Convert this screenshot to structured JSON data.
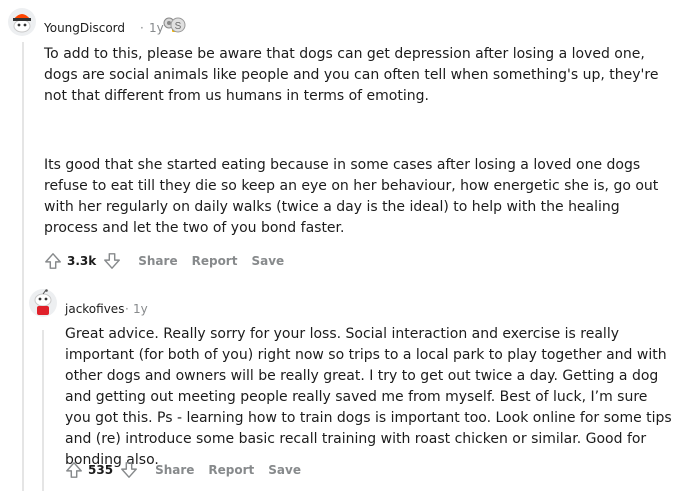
{
  "comments": [
    {
      "username": "YoungDiscord",
      "separator": "·",
      "age": "1y",
      "awards": [
        "helpful-award-icon",
        "silver-coin-award-icon"
      ],
      "paragraphs": [
        "To add to this, please be aware that dogs can get depression after losing a loved one, dogs are social animals like people and you can often tell when something's up, they're not that different from us humans in terms of emoting.",
        "Its good that she started eating because in some cases after losing a loved one dogs refuse to eat till they die so keep an eye on her behaviour, how energetic she is, go out with her regularly on daily walks (twice a day is the ideal) to help with the healing process and let the two of you bond faster."
      ],
      "votes": "3.3k",
      "actions": {
        "share": "Share",
        "report": "Report",
        "save": "Save"
      }
    },
    {
      "username": "jackofives",
      "separator": "·",
      "age": "1y",
      "paragraphs": [
        "Great advice. Really sorry for your loss. Social interaction and exercise is really important (for both of you) right now so trips to a local park to play together and with other dogs and owners will be really great. I try to get out twice a day. Getting a dog and getting out meeting people really saved me from myself. Best of luck, I’m sure you got this. Ps - learning how to train dogs is important too. Look online for some tips and (re) introduce some basic recall training with roast chicken or similar. Good for bonding also."
      ],
      "votes": "535",
      "actions": {
        "share": "Share",
        "report": "Report",
        "save": "Save"
      }
    }
  ],
  "colors": {
    "text": "#1c1c1c",
    "meta": "#878a8c",
    "thread": "#e5e5e5",
    "avatar_bg": "#edeff1"
  }
}
